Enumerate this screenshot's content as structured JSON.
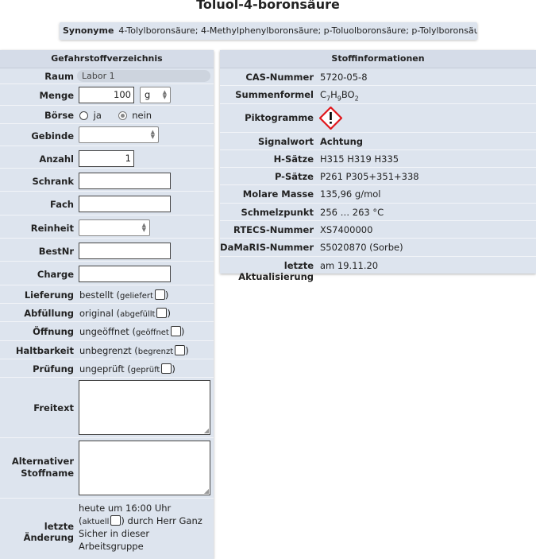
{
  "title": "Toluol-4-boronsäure",
  "synonyms": {
    "label": "Synonyme",
    "value": "4-Tolylboronsäure; 4-Methylphenylboronsäure; p-Toluolboronsäure; p-Tolylboronsäure"
  },
  "left": {
    "heading": "Gefahrstoffverzeichnis",
    "raum_label": "Raum",
    "raum_value": "Labor 1",
    "menge_label": "Menge",
    "menge_value": "100",
    "menge_unit": "g",
    "boerse_label": "Börse",
    "boerse_ja": "ja",
    "boerse_nein": "nein",
    "gebinde_label": "Gebinde",
    "anzahl_label": "Anzahl",
    "anzahl_value": "1",
    "schrank_label": "Schrank",
    "fach_label": "Fach",
    "reinheit_label": "Reinheit",
    "bestnr_label": "BestNr",
    "charge_label": "Charge",
    "lieferung_label": "Lieferung",
    "lieferung_value": "bestellt (",
    "lieferung_check": "geliefert",
    "lieferung_close": ")",
    "abfuellung_label": "Abfüllung",
    "abfuellung_value": "original (",
    "abfuellung_check": "abgefüllt",
    "abfuellung_close": ")",
    "oeffnung_label": "Öffnung",
    "oeffnung_value": "ungeöffnet (",
    "oeffnung_check": "geöffnet",
    "oeffnung_close": ")",
    "haltbarkeit_label": "Haltbarkeit",
    "haltbarkeit_value": "unbegrenzt (",
    "haltbarkeit_check": "begrenzt",
    "haltbarkeit_close": ")",
    "pruefung_label": "Prüfung",
    "pruefung_value": "ungeprüft (",
    "pruefung_check": "geprüft",
    "pruefung_close": ")",
    "freitext_label": "Freitext",
    "altname_label1": "Alternativer",
    "altname_label2": "Stoffname",
    "aenderung_label": "letzte Änderung",
    "aenderung_line1": "heute um 16:00 Uhr",
    "aenderung_line2a": "(",
    "aenderung_line2b": "aktuell",
    "aenderung_line2c": ") durch Herr Ganz",
    "aenderung_line3": "Sicher in dieser",
    "aenderung_line4": "Arbeitsgruppe"
  },
  "right": {
    "heading": "Stoffinformationen",
    "rows": [
      {
        "label": "CAS-Nummer",
        "value": "5720-05-8"
      },
      {
        "label": "Summenformel",
        "value": "C7H9BO2"
      },
      {
        "label": "Piktogramme",
        "value": ""
      },
      {
        "label": "Signalwort",
        "value": "Achtung"
      },
      {
        "label": "H-Sätze",
        "value": "H315 H319 H335"
      },
      {
        "label": "P-Sätze",
        "value": "P261 P305+351+338"
      },
      {
        "label": "Molare Masse",
        "value": "135,96 g/mol"
      },
      {
        "label": "Schmelzpunkt",
        "value": "256 … 263 °C"
      },
      {
        "label": "RTECS-Nummer",
        "value": "XS7400000"
      },
      {
        "label": "DaMaRIS-Nummer",
        "value": "S5020870 (Sorbe)"
      },
      {
        "label": "letzte Aktualisierung",
        "value": "am 19.11.20"
      }
    ],
    "formula_parts": [
      "C",
      "7",
      "H",
      "9",
      "BO",
      "2"
    ],
    "pictogram_icon": "ghs07-exclamation-icon",
    "pictogram_color": "#e0161b"
  }
}
